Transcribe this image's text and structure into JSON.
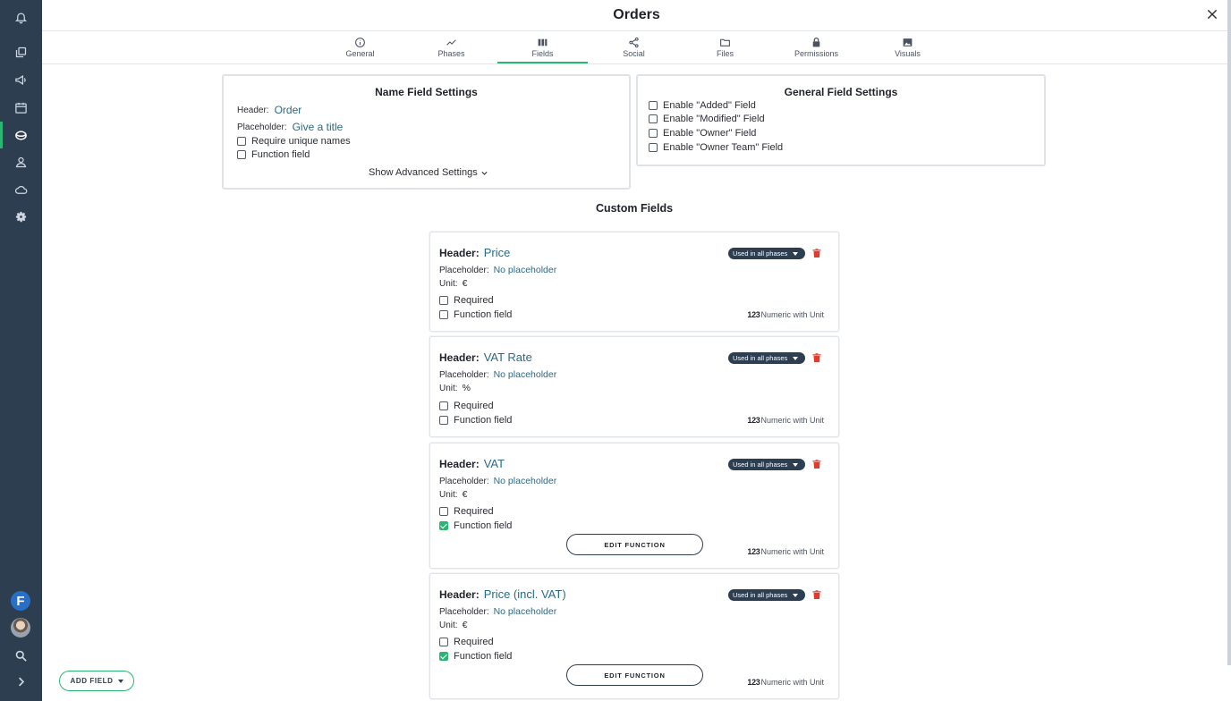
{
  "header": {
    "title": "Orders"
  },
  "tabs": [
    {
      "label": "General",
      "icon": "info-icon"
    },
    {
      "label": "Phases",
      "icon": "line-chart-icon"
    },
    {
      "label": "Fields",
      "icon": "columns-icon",
      "active": true
    },
    {
      "label": "Social",
      "icon": "share-icon"
    },
    {
      "label": "Files",
      "icon": "folder-icon"
    },
    {
      "label": "Permissions",
      "icon": "lock-icon"
    },
    {
      "label": "Visuals",
      "icon": "image-icon"
    }
  ],
  "sidebar": {
    "items": [
      "bell-icon",
      "copy-icon",
      "megaphone-icon",
      "calendar-icon",
      "workspace-icon",
      "users-icon",
      "cloud-icon",
      "gear-icon"
    ],
    "user_initial": "F",
    "bottom_icons": [
      "search-icon",
      "chevron-right-icon"
    ]
  },
  "name_field_settings": {
    "title": "Name Field Settings",
    "header_label": "Header:",
    "header_value": "Order",
    "placeholder_label": "Placeholder:",
    "placeholder_value": "Give a title",
    "require_unique": "Require unique names",
    "function_field": "Function field",
    "advanced": "Show Advanced Settings"
  },
  "general_field_settings": {
    "title": "General Field Settings",
    "options": [
      "Enable \"Added\" Field",
      "Enable \"Modified\" Field",
      "Enable \"Owner\" Field",
      "Enable \"Owner Team\" Field"
    ]
  },
  "custom_fields": {
    "title": "Custom Fields",
    "header_label": "Header:",
    "placeholder_label": "Placeholder:",
    "unit_label": "Unit:",
    "required_label": "Required",
    "function_label": "Function field",
    "phases_badge": "Used in all phases",
    "type_prefix": "123",
    "type_label": "Numeric with Unit",
    "edit_function": "EDIT FUNCTION",
    "items": [
      {
        "header": "Price",
        "placeholder": "No placeholder",
        "unit": "€",
        "required": false,
        "function": false
      },
      {
        "header": "VAT Rate",
        "placeholder": "No placeholder",
        "unit": "%",
        "required": false,
        "function": false
      },
      {
        "header": "VAT",
        "placeholder": "No placeholder",
        "unit": "€",
        "required": false,
        "function": true
      },
      {
        "header": "Price (incl. VAT)",
        "placeholder": "No placeholder",
        "unit": "€",
        "required": false,
        "function": true
      }
    ]
  },
  "add_field_label": "ADD FIELD",
  "colors": {
    "sidebar": "#2d3e50",
    "accent": "#2bb673",
    "delete": "#e03b2c",
    "value_text": "#2a6a86"
  }
}
